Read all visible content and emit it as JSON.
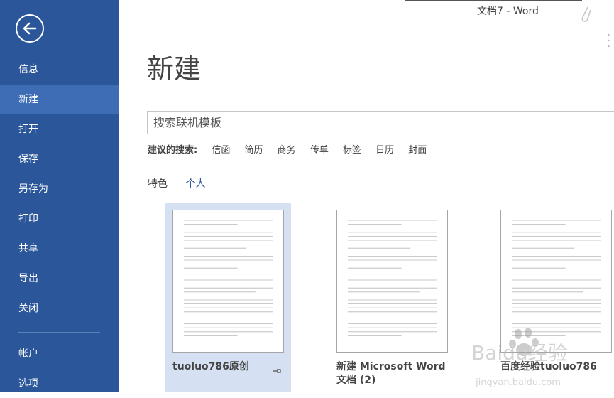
{
  "window": {
    "title": "文档7 - Word"
  },
  "sidebar": {
    "items": [
      {
        "label": "信息",
        "active": false
      },
      {
        "label": "新建",
        "active": true
      },
      {
        "label": "打开",
        "active": false
      },
      {
        "label": "保存",
        "active": false
      },
      {
        "label": "另存为",
        "active": false
      },
      {
        "label": "打印",
        "active": false
      },
      {
        "label": "共享",
        "active": false
      },
      {
        "label": "导出",
        "active": false
      },
      {
        "label": "关闭",
        "active": false
      },
      {
        "label": "帐户",
        "active": false
      },
      {
        "label": "选项",
        "active": false
      }
    ]
  },
  "main": {
    "title": "新建",
    "search": {
      "placeholder": "搜索联机模板"
    },
    "suggested": {
      "label": "建议的搜索:",
      "tags": [
        "信函",
        "简历",
        "商务",
        "传单",
        "标签",
        "日历",
        "封面"
      ]
    },
    "tabs": [
      {
        "label": "特色",
        "active": false
      },
      {
        "label": "个人",
        "active": true
      }
    ],
    "templates": [
      {
        "name": "tuoluo786原创",
        "selected": true,
        "pinned": true
      },
      {
        "name": "新建 Microsoft Word 文档 (2)",
        "selected": false,
        "pinned": false
      },
      {
        "name": "百度经验tuoluo786",
        "selected": false,
        "pinned": false
      }
    ]
  },
  "watermark": {
    "brand": "Baidu经验",
    "sub": "jingyan.baidu.com"
  },
  "colors": {
    "sidebar": "#2b579a",
    "sidebar_active": "#3e6db5",
    "accent": "#2b579a",
    "tile_selected": "#d5e1f2"
  }
}
